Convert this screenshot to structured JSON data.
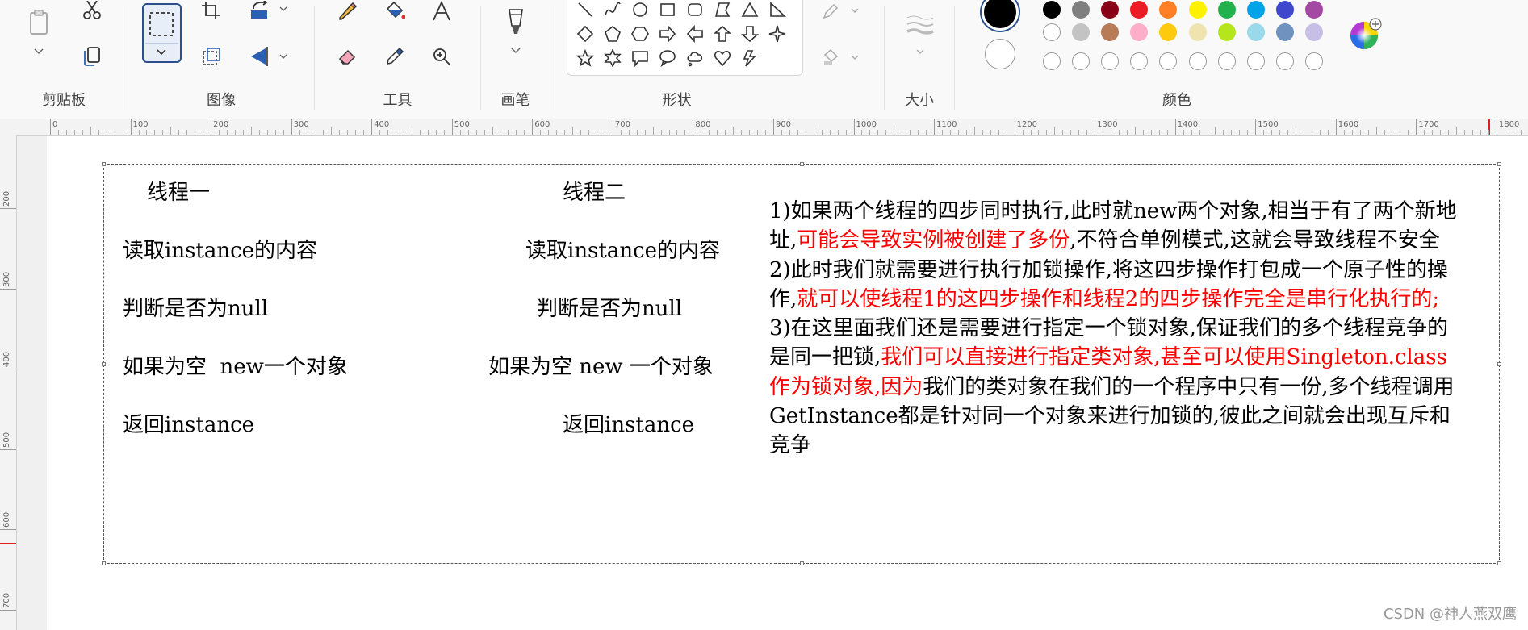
{
  "ribbon": {
    "groups": {
      "clipboard": "剪贴板",
      "image": "图像",
      "tools": "工具",
      "brushes": "画笔",
      "shapes": "形状",
      "size": "大小",
      "colors": "颜色"
    },
    "colors": {
      "color1": "#000000",
      "color2": "#ffffff",
      "palette_row1": [
        "#000000",
        "#7f7f7f",
        "#880015",
        "#ed1c24",
        "#ff7f27",
        "#fff200",
        "#22b14c",
        "#00a2e8",
        "#3f48cc",
        "#a349a4"
      ],
      "palette_row2": [
        "#ffffff",
        "#c3c3c3",
        "#b97a57",
        "#ffaec9",
        "#ffc90e",
        "#efe4b0",
        "#b5e61d",
        "#99d9ea",
        "#7092be",
        "#c8bfe7"
      ],
      "palette_row3_count": 10
    },
    "shape_icons": [
      "line-icon",
      "curve-icon",
      "oval-icon",
      "rectangle-icon",
      "rounded-rectangle-icon",
      "polygon-icon",
      "triangle-icon",
      "right-triangle-icon",
      "diamond-icon",
      "pentagon-icon",
      "hexagon-icon",
      "right-arrow-icon",
      "left-arrow-icon",
      "up-arrow-icon",
      "down-arrow-icon",
      "four-point-star-icon",
      "five-point-star-icon",
      "six-point-star-icon",
      "rect-callout-icon",
      "oval-callout-icon",
      "cloud-callout-icon",
      "heart-icon",
      "lightning-icon"
    ]
  },
  "ruler": {
    "h_ticks": [
      "0",
      "100",
      "200",
      "300",
      "400",
      "500",
      "600",
      "700",
      "800",
      "900",
      "1000",
      "1100",
      "1200",
      "1300",
      "1400",
      "1500",
      "1600",
      "1700",
      "1800"
    ],
    "v_ticks": [
      "200",
      "300",
      "400",
      "500",
      "600",
      "700"
    ]
  },
  "canvas": {
    "col1": {
      "header": "线程一",
      "step1": "读取instance的内容",
      "step2": "判断是否为null",
      "step3": "如果为空  new一个对象",
      "step4": "返回instance"
    },
    "col2": {
      "header": "线程二",
      "step1": "读取instance的内容",
      "step2": "判断是否为null",
      "step3": "如果为空 new 一个对象",
      "step4": "返回instance"
    },
    "notes": {
      "p1_a": "1)如果两个线程的四步同时执行,此时就new两个对象,相当于有了两个新地址,",
      "p1_red": "可能会导致实例被创建了多份",
      "p1_b": ",不符合单例模式,这就会导致线程不安全",
      "p2_a": "2)此时我们就需要进行执行加锁操作,将这四步操作打包成一个原子性的操作,",
      "p2_red": "就可以使线程1的这四步操作和线程2的四步操作完全是串行化执行的;",
      "p3_a": "3)在这里面我们还是需要进行指定一个锁对象,保证我们的多个线程竞争的是同一把锁,",
      "p3_red": "我们可以直接进行指定类对象,甚至可以使用Singleton.class作为锁对象,因为",
      "p3_b": "我们的类对象在我们的一个程序中只有一份,多个线程调用GetInstance都是针对同一个对象来进行加锁的,彼此之间就会出现互斥和竞争"
    }
  },
  "watermark": "CSDN @神人燕双鹰"
}
